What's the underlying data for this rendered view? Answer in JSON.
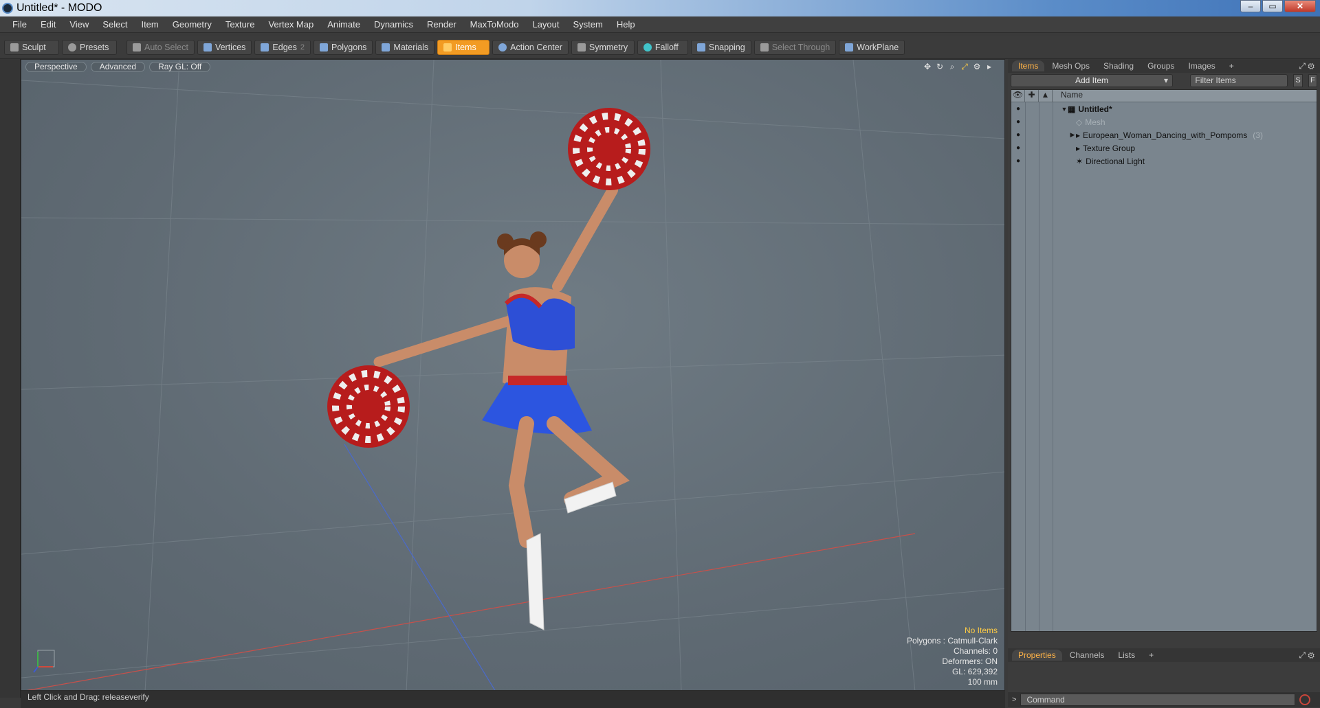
{
  "window": {
    "title": "Untitled* - MODO",
    "buttons": {
      "min": "‒",
      "max": "▭",
      "close": "✕"
    }
  },
  "menu": [
    "File",
    "Edit",
    "View",
    "Select",
    "Item",
    "Geometry",
    "Texture",
    "Vertex Map",
    "Animate",
    "Dynamics",
    "Render",
    "MaxToModo",
    "Layout",
    "System",
    "Help"
  ],
  "toolbar": {
    "sculpt": "Sculpt",
    "presets": "Presets",
    "auto_select": "Auto Select",
    "vertices": "Vertices",
    "edges": "Edges",
    "edges_count": "2",
    "polygons": "Polygons",
    "materials": "Materials",
    "items": "Items",
    "action_center": "Action Center",
    "symmetry": "Symmetry",
    "falloff": "Falloff",
    "snapping": "Snapping",
    "select_through": "Select Through",
    "workplane": "WorkPlane"
  },
  "viewport": {
    "tabs": [
      "Perspective",
      "Advanced",
      "Ray GL: Off"
    ],
    "stats": {
      "items": "No Items",
      "polygons": "Polygons : Catmull-Clark",
      "channels": "Channels: 0",
      "deformers": "Deformers: ON",
      "gl": "GL: 629,392",
      "scale": "100 mm"
    },
    "status": "Left Click and Drag:  releaseverify"
  },
  "right_panel": {
    "tabs": [
      "Items",
      "Mesh Ops",
      "Shading",
      "Groups",
      "Images",
      "+"
    ],
    "add_item": "Add Item",
    "filter_placeholder": "Filter Items",
    "s_btn": "S",
    "f_btn": "F",
    "column_name": "Name",
    "tree": [
      {
        "label": "Untitled*",
        "count": ""
      },
      {
        "label": "Mesh",
        "count": ""
      },
      {
        "label": "European_Woman_Dancing_with_Pompoms",
        "count": "(3)"
      },
      {
        "label": "Texture Group",
        "count": ""
      },
      {
        "label": "Directional Light",
        "count": ""
      }
    ],
    "bottom_tabs": [
      "Properties",
      "Channels",
      "Lists",
      "+"
    ],
    "command_placeholder": "Command",
    "command_prompt": ">"
  },
  "colors": {
    "accent": "#f29b23",
    "viewport_bg": "#616c75",
    "tree_bg": "#7a858e"
  }
}
